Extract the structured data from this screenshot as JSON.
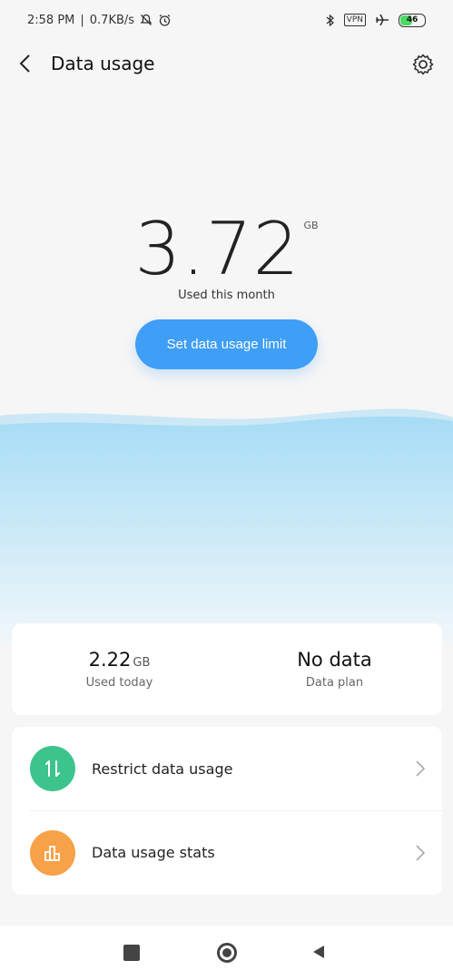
{
  "status_bar": {
    "time": "2:58 PM",
    "speed": "0.7KB/s",
    "vpn": "VPN",
    "battery": "46"
  },
  "header": {
    "title": "Data usage"
  },
  "hero": {
    "value": "3.72",
    "unit": "GB",
    "caption": "Used this month",
    "button_label": "Set data usage limit"
  },
  "summary": {
    "today_value": "2.22",
    "today_unit": "GB",
    "today_label": "Used today",
    "plan_value": "No data",
    "plan_label": "Data plan"
  },
  "menu": {
    "items": [
      {
        "label": "Restrict data usage",
        "icon_color": "#3cc48c"
      },
      {
        "label": "Data usage stats",
        "icon_color": "#f7a148"
      }
    ]
  },
  "colors": {
    "accent": "#3f9ef5",
    "wave_top": "#a6dcf5",
    "wave_bottom": "#eef7fb"
  }
}
